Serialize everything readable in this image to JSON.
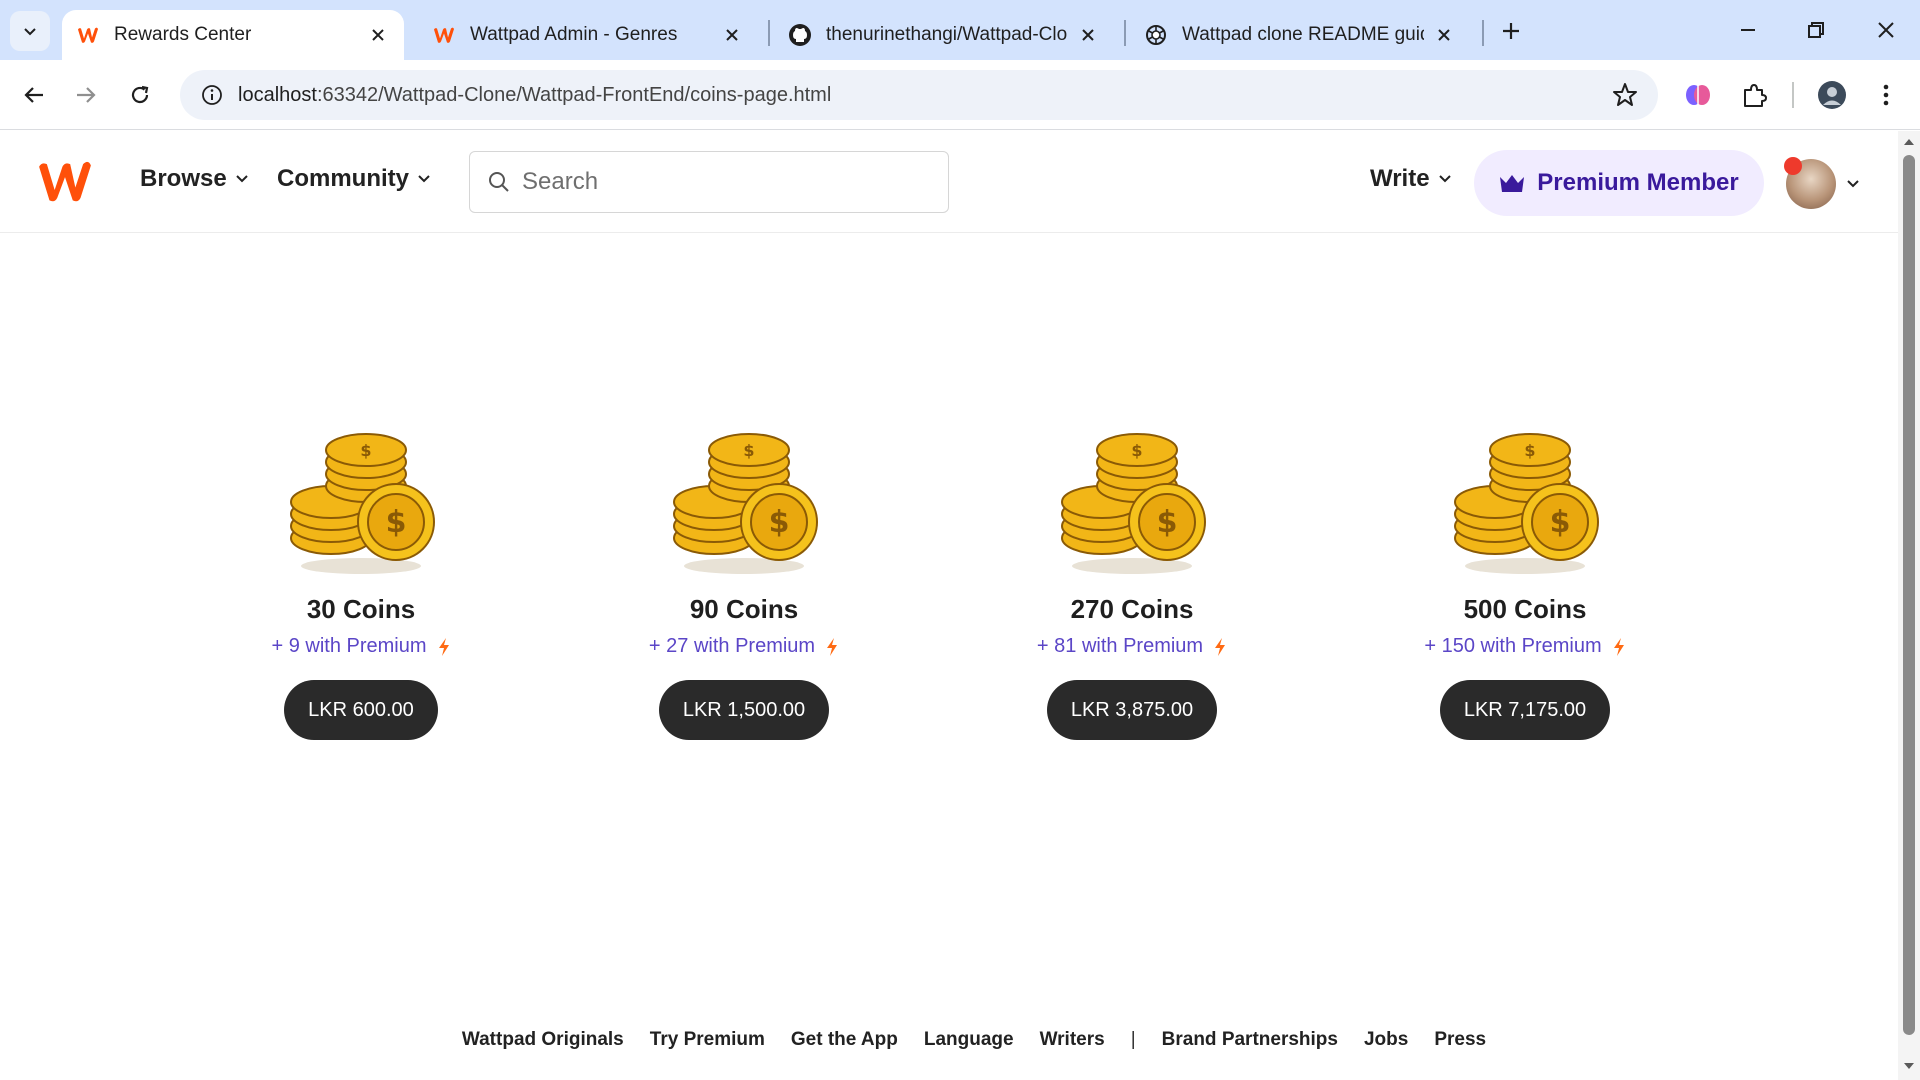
{
  "browser": {
    "tabs": [
      {
        "title": "Rewards Center",
        "icon": "wattpad-favicon",
        "active": true
      },
      {
        "title": "Wattpad Admin - Genres",
        "icon": "wattpad-favicon",
        "active": false
      },
      {
        "title": "thenurinethangi/Wattpad-Clone",
        "icon": "github-favicon",
        "active": false
      },
      {
        "title": "Wattpad clone README guide",
        "icon": "chatgpt-favicon",
        "active": false
      }
    ],
    "url_host": "localhost",
    "url_path": ":63342/Wattpad-Clone/Wattpad-FrontEnd/coins-page.html"
  },
  "header": {
    "nav": [
      {
        "label": "Browse"
      },
      {
        "label": "Community"
      }
    ],
    "search_placeholder": "Search",
    "write_label": "Write",
    "premium_label": "Premium Member"
  },
  "packages": [
    {
      "title": "30 Coins",
      "bonus": "+ 9 with Premium",
      "price": "LKR 600.00"
    },
    {
      "title": "90 Coins",
      "bonus": "+ 27 with Premium",
      "price": "LKR 1,500.00"
    },
    {
      "title": "270 Coins",
      "bonus": "+ 81 with Premium",
      "price": "LKR 3,875.00"
    },
    {
      "title": "500 Coins",
      "bonus": "+ 150 with Premium",
      "price": "LKR 7,175.00"
    }
  ],
  "footer": {
    "links": [
      "Wattpad Originals",
      "Try Premium",
      "Get the App",
      "Language",
      "Writers"
    ],
    "separator": "|",
    "links2": [
      "Brand Partnerships",
      "Jobs",
      "Press"
    ]
  },
  "colors": {
    "brand": "#ff500a",
    "premium_bg": "#f1ecff",
    "premium_text": "#3a1a9c",
    "bonus_text": "#5b46c7",
    "price_button": "#2a2a2a"
  }
}
